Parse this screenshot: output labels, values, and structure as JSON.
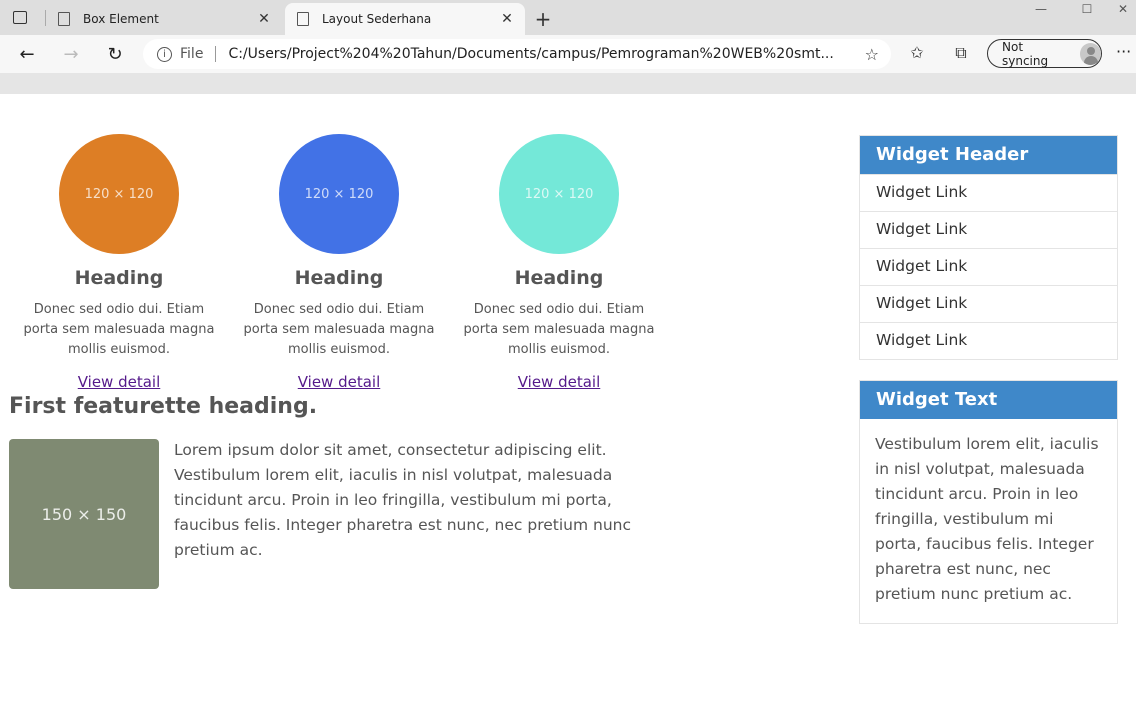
{
  "browser": {
    "tabs": [
      {
        "title": "Box Element",
        "active": false
      },
      {
        "title": "Layout Sederhana",
        "active": true
      }
    ],
    "address": {
      "scheme": "File",
      "url": "C:/Users/Project%204%20Tahun/Documents/campus/Pemrograman%20WEB%20smt..."
    },
    "sync_label": "Not syncing"
  },
  "features": [
    {
      "placeholder": "120 × 120",
      "heading": "Heading",
      "text": "Donec sed odio dui. Etiam porta sem malesuada magna mollis euismod.",
      "link": "View detail",
      "color": "#dd7e25"
    },
    {
      "placeholder": "120 × 120",
      "heading": "Heading",
      "text": "Donec sed odio dui. Etiam porta sem malesuada magna mollis euismod.",
      "link": "View detail",
      "color": "#4272e6"
    },
    {
      "placeholder": "120 × 120",
      "heading": "Heading",
      "text": "Donec sed odio dui. Etiam porta sem malesuada magna mollis euismod.",
      "link": "View detail",
      "color": "#74e8d8"
    }
  ],
  "featurette": {
    "heading": "First featurette heading.",
    "image_placeholder": "150 × 150",
    "text": "Lorem ipsum dolor sit amet, consectetur adipiscing elit. Vestibulum lorem elit, iaculis in nisl volutpat, malesuada tincidunt arcu. Proin in leo fringilla, vestibulum mi porta, faucibus felis. Integer pharetra est nunc, nec pretium nunc pretium ac."
  },
  "sidebar": {
    "links_widget": {
      "header": "Widget Header",
      "links": [
        "Widget Link",
        "Widget Link",
        "Widget Link",
        "Widget Link",
        "Widget Link"
      ]
    },
    "text_widget": {
      "header": "Widget Text",
      "text": "Vestibulum lorem elit, iaculis in nisl volutpat, malesuada tincidunt arcu. Proin in leo fringilla, vestibulum mi porta, faucibus felis. Integer pharetra est nunc, nec pretium nunc pretium ac."
    }
  },
  "colors": {
    "widget_header": "#3f88c9",
    "featurette_image": "#7f8a72"
  }
}
